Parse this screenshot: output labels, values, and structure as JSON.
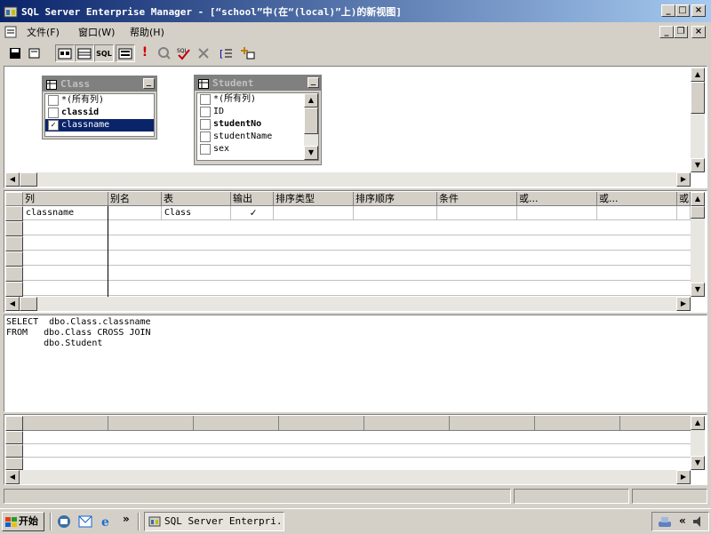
{
  "window": {
    "title": "SQL Server Enterprise Manager - [“school”中(在“(local)”上)的新视图]"
  },
  "menu": {
    "items": [
      "文件(F)",
      "窗口(W)",
      "帮助(H)"
    ]
  },
  "diagram": {
    "tables": [
      {
        "name": "Class",
        "columns": [
          {
            "label": "*(所有列)",
            "checked": false,
            "bold": false,
            "selected": false
          },
          {
            "label": "classid",
            "checked": false,
            "bold": true,
            "selected": false
          },
          {
            "label": "classname",
            "checked": true,
            "bold": false,
            "selected": true
          }
        ]
      },
      {
        "name": "Student",
        "columns": [
          {
            "label": "*(所有列)",
            "checked": false,
            "bold": false,
            "selected": false
          },
          {
            "label": "ID",
            "checked": false,
            "bold": false,
            "selected": false
          },
          {
            "label": "studentNo",
            "checked": false,
            "bold": true,
            "selected": false
          },
          {
            "label": "studentName",
            "checked": false,
            "bold": false,
            "selected": false
          },
          {
            "label": "sex",
            "checked": false,
            "bold": false,
            "selected": false
          }
        ]
      }
    ]
  },
  "grid": {
    "headers": [
      "列",
      "别名",
      "表",
      "输出",
      "排序类型",
      "排序顺序",
      "条件",
      "或...",
      "或...",
      "或..."
    ],
    "rows": [
      {
        "column": "classname",
        "alias": "",
        "table": "Class",
        "output": "✓"
      }
    ]
  },
  "sql": {
    "text": "SELECT  dbo.Class.classname\nFROM   dbo.Class CROSS JOIN\n       dbo.Student"
  },
  "taskbar": {
    "start_label": "开始",
    "chevron": "»",
    "task_label": "SQL Server Enterpri...",
    "tray_chevron": "«"
  }
}
